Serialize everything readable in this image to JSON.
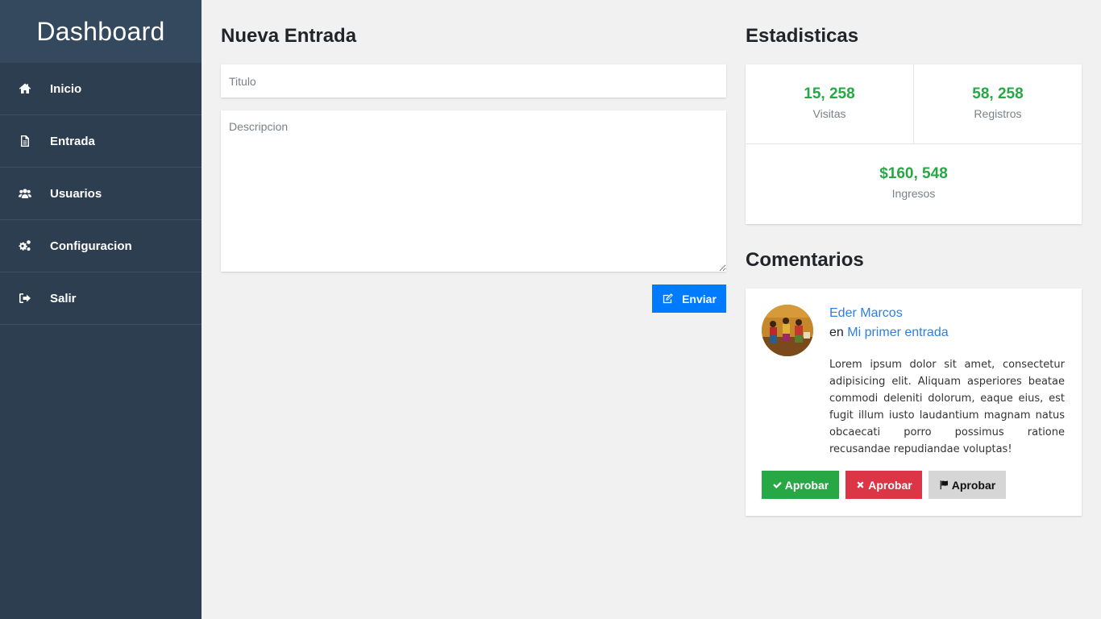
{
  "sidebar": {
    "brand": "Dashboard",
    "items": [
      {
        "label": "Inicio",
        "icon": "home-icon"
      },
      {
        "label": "Entrada",
        "icon": "document-icon"
      },
      {
        "label": "Usuarios",
        "icon": "users-icon"
      },
      {
        "label": "Configuracion",
        "icon": "gears-icon"
      },
      {
        "label": "Salir",
        "icon": "sign-out-icon"
      }
    ]
  },
  "new_entry": {
    "title": "Nueva Entrada",
    "title_placeholder": "Titulo",
    "description_placeholder": "Descripcion",
    "submit_label": "Enviar",
    "submit_icon": "edit-icon"
  },
  "stats": {
    "title": "Estadisticas",
    "visitas": {
      "value": "15, 258",
      "label": "Visitas"
    },
    "registros": {
      "value": "58, 258",
      "label": "Registros"
    },
    "ingresos": {
      "value": "$160, 548",
      "label": "Ingresos"
    },
    "value_color": "#28a745"
  },
  "comments": {
    "title": "Comentarios",
    "items": [
      {
        "author": "Eder Marcos",
        "prefix": "en",
        "post": "Mi primer entrada",
        "text": "Lorem ipsum dolor sit amet, consectetur adipisicing elit. Aliquam asperiores beatae commodi deleniti dolorum, eaque eius, est fugit illum iusto laudantium magnam natus obcaecati porro possimus ratione recusandae repudiandae voluptas!",
        "actions": [
          {
            "label": "Aprobar",
            "icon": "check-icon",
            "color": "#28a745"
          },
          {
            "label": "Aprobar",
            "icon": "times-icon",
            "color": "#dc3545"
          },
          {
            "label": "Aprobar",
            "icon": "flag-icon",
            "color": "#d6d6d6"
          }
        ]
      }
    ]
  },
  "colors": {
    "sidebar_bg": "#2c3e50",
    "brand_bg": "#34495e",
    "primary": "#007bff",
    "link": "#2d7fe0"
  }
}
